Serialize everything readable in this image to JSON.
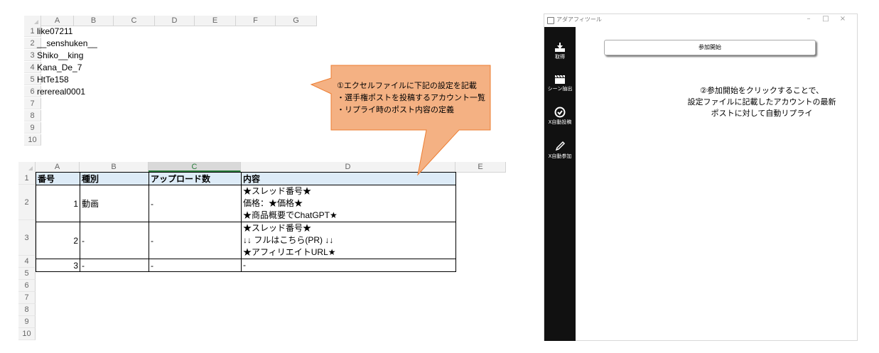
{
  "sheet1": {
    "columns": [
      "A",
      "B",
      "C",
      "D",
      "E",
      "F",
      "G"
    ],
    "rows": [
      "1",
      "2",
      "3",
      "4",
      "5",
      "6",
      "7",
      "8",
      "9",
      "10"
    ],
    "values": [
      "like07211",
      "__senshuken__",
      "Shiko__king",
      "Kana_De_7",
      "HtTe158",
      "rerereal0001"
    ]
  },
  "sheet2": {
    "columns": [
      "A",
      "B",
      "C",
      "D",
      "E"
    ],
    "rows": [
      "1",
      "2",
      "3",
      "4",
      "5",
      "6",
      "7",
      "8",
      "9",
      "10"
    ],
    "headers": [
      "番号",
      "種別",
      "アップロード数",
      "内容"
    ],
    "data": [
      {
        "no": "1",
        "type": "動画",
        "uploads": "-",
        "content": [
          "★スレッド番号★",
          "価格：★価格★",
          "★商品概要でChatGPT★"
        ]
      },
      {
        "no": "2",
        "type": "-",
        "uploads": "-",
        "content": [
          "★スレッド番号★",
          "↓↓ フルはこちら(PR) ↓↓",
          "★アフィリエイトURL★"
        ]
      },
      {
        "no": "3",
        "type": "-",
        "uploads": "-",
        "content": [
          "-"
        ]
      }
    ]
  },
  "callout1": {
    "lines": [
      "①エクセルファイルに下記の設定を記載",
      "・選手権ポストを投稿するアカウント一覧",
      "・リプライ時のポスト内容の定義"
    ],
    "fill": "#f4b183",
    "stroke": "#ed7d31"
  },
  "callout2": {
    "lines": [
      "②参加開始をクリックすることで、",
      "設定ファイルに記載したアカウントの最新",
      "ポストに対して自動リプライ"
    ],
    "fill": "#f4b183",
    "stroke": "#ed7d31"
  },
  "app": {
    "title": "アダアフィツール",
    "start_label": "参加開始",
    "nav": [
      {
        "label": "取得",
        "icon": "download-icon"
      },
      {
        "label": "シーン抽出",
        "icon": "clapperboard-icon"
      },
      {
        "label": "X自動投稿",
        "icon": "check-circle-icon"
      },
      {
        "label": "X自動参加",
        "icon": "pencil-icon"
      }
    ]
  }
}
